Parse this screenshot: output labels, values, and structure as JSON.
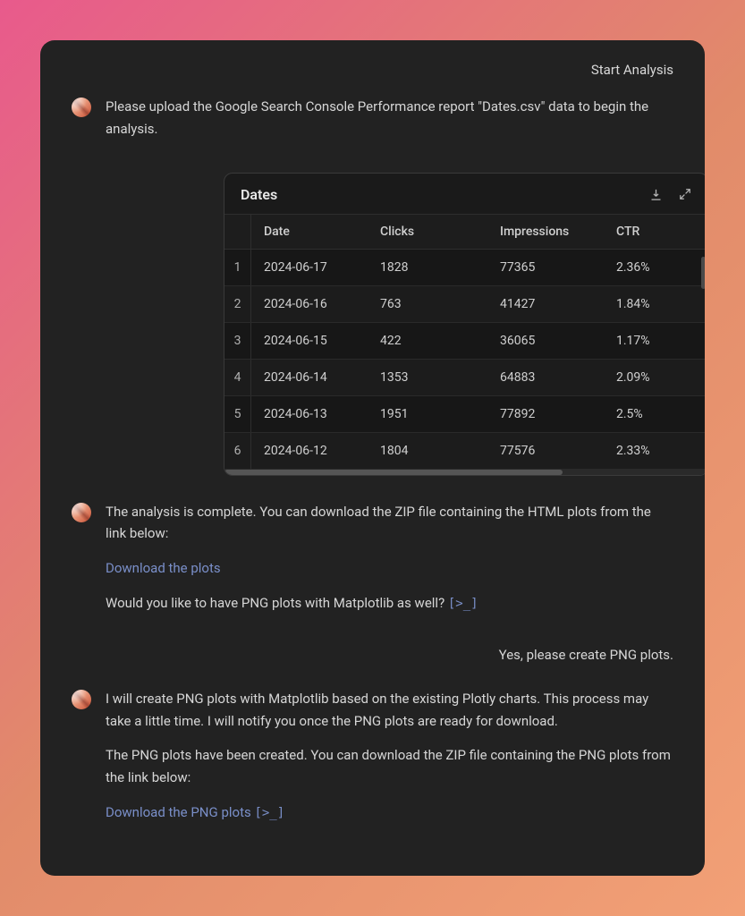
{
  "header": {
    "action_label": "Start Analysis"
  },
  "messages": {
    "m1": "Please upload the Google Search Console Performance report \"Dates.csv\" data to begin the analysis.",
    "m2_p1": "The analysis is complete. You can download the ZIP file containing the HTML plots from the link below:",
    "m2_link": "Download the plots",
    "m2_p2": "Would you like to have PNG plots with Matplotlib as well? ",
    "m2_hint": "[>_]",
    "user1": "Yes, please create PNG plots.",
    "m3_p1": "I will create PNG plots with Matplotlib based on the existing Plotly charts. This process may take a little time. I will notify you once the PNG plots are ready for download.",
    "m3_p2": "The PNG plots have been created. You can download the ZIP file containing the PNG plots from the link below:",
    "m3_link": "Download the PNG plots ",
    "m3_hint": "[>_]"
  },
  "table": {
    "title": "Dates",
    "headers": {
      "date": "Date",
      "clicks": "Clicks",
      "impressions": "Impressions",
      "ctr": "CTR"
    },
    "rows": [
      {
        "idx": "1",
        "date": "2024-06-17",
        "clicks": "1828",
        "impressions": "77365",
        "ctr": "2.36%"
      },
      {
        "idx": "2",
        "date": "2024-06-16",
        "clicks": "763",
        "impressions": "41427",
        "ctr": "1.84%"
      },
      {
        "idx": "3",
        "date": "2024-06-15",
        "clicks": "422",
        "impressions": "36065",
        "ctr": "1.17%"
      },
      {
        "idx": "4",
        "date": "2024-06-14",
        "clicks": "1353",
        "impressions": "64883",
        "ctr": "2.09%"
      },
      {
        "idx": "5",
        "date": "2024-06-13",
        "clicks": "1951",
        "impressions": "77892",
        "ctr": "2.5%"
      },
      {
        "idx": "6",
        "date": "2024-06-12",
        "clicks": "1804",
        "impressions": "77576",
        "ctr": "2.33%"
      }
    ]
  }
}
